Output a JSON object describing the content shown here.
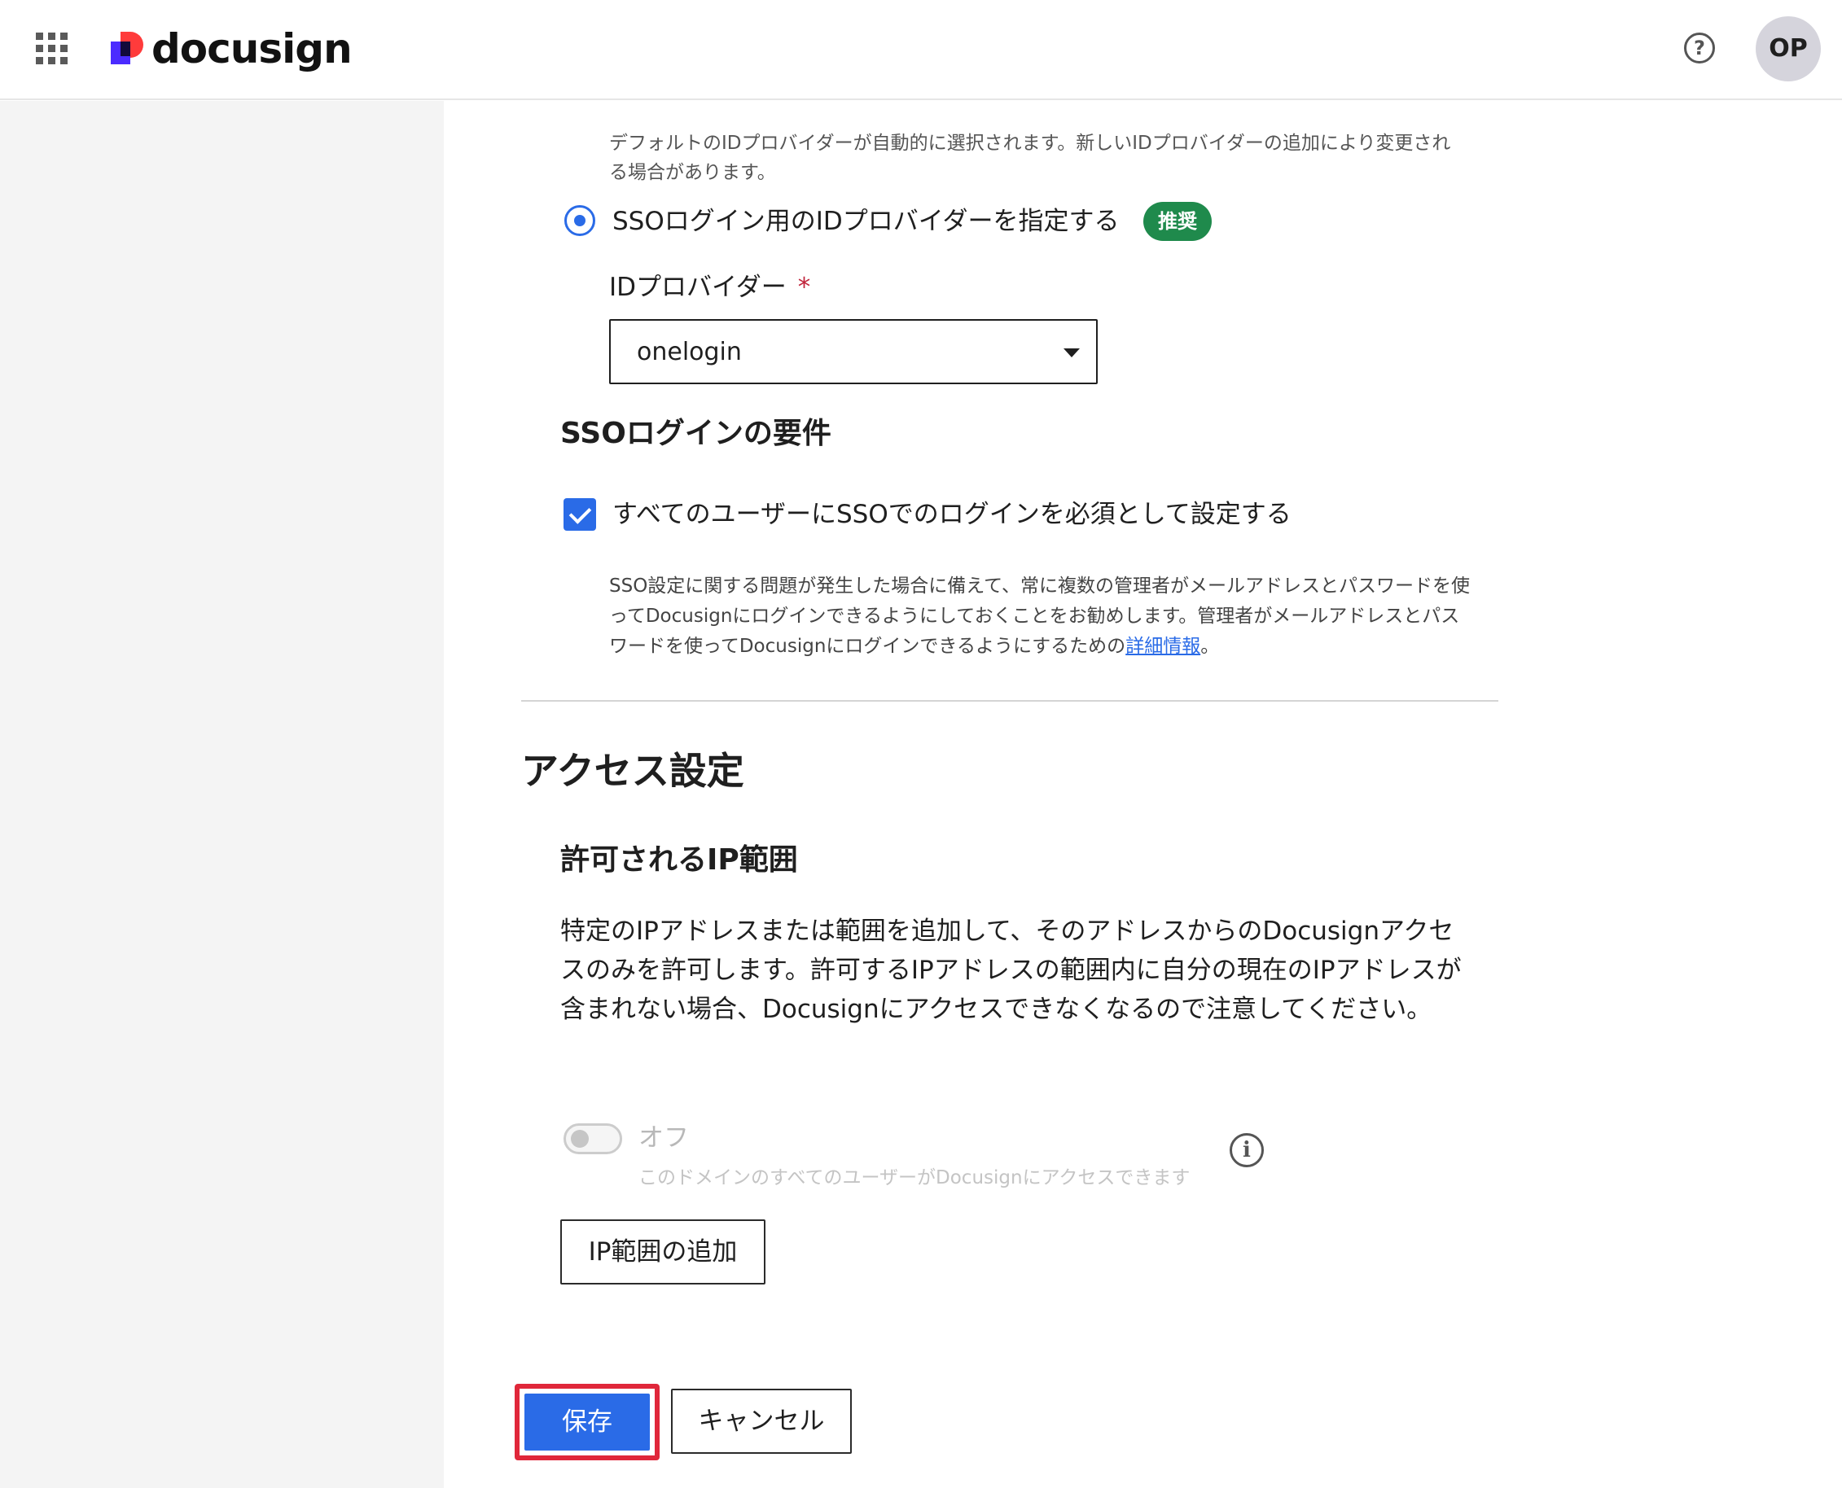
{
  "header": {
    "logo_text": "docusign",
    "help_icon": "?",
    "avatar_initials": "OP"
  },
  "sso": {
    "default_note": "デフォルトのIDプロバイダーが自動的に選択されます。新しいIDプロバイダーの追加により変更される場合があります。",
    "radio_label": "SSOログイン用のIDプロバイダーを指定する",
    "radio_selected": true,
    "badge": "推奨",
    "idp_label": "IDプロバイダー",
    "required_mark": "*",
    "idp_value": "onelogin",
    "requirements_title": "SSOログインの要件",
    "require_checkbox_label": "すべてのユーザーにSSOでのログインを必須として設定する",
    "require_checked": true,
    "info_text": "SSO設定に関する問題が発生した場合に備えて、常に複数の管理者がメールアドレスとパスワードを使ってDocusignにログインできるようにしておくことをお勧めします。管理者がメールアドレスとパスワードを使ってDocusignにログインできるようにするための",
    "info_link": "詳細情報",
    "info_end": "。"
  },
  "access": {
    "title": "アクセス設定",
    "ip_title": "許可されるIP範囲",
    "ip_desc": "特定のIPアドレスまたは範囲を追加して、そのアドレスからのDocusignアクセスのみを許可します。許可するIPアドレスの範囲内に自分の現在のIPアドレスが含まれない場合、Docusignにアクセスできなくなるので注意してください。",
    "toggle_label": "オフ",
    "toggle_sub": "このドメインのすべてのユーザーがDocusignにアクセスできます",
    "info_icon": "i",
    "add_button": "IP範囲の追加"
  },
  "actions": {
    "save": "保存",
    "cancel": "キャンセル"
  },
  "colors": {
    "accent": "#2a6be7",
    "badge": "#1f8a4c",
    "highlight": "#e0273a"
  }
}
